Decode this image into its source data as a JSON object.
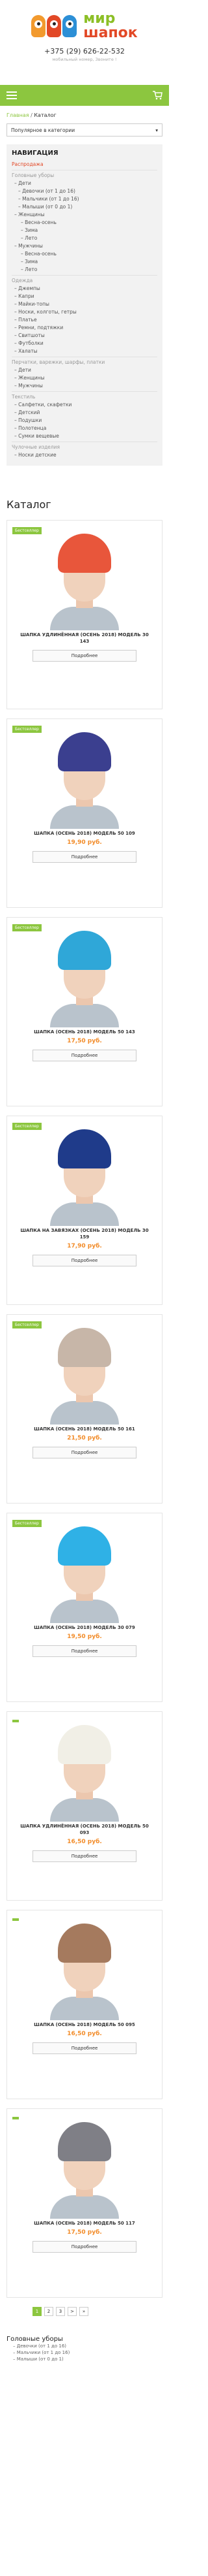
{
  "brand": {
    "line1": "мир",
    "line2": "шапок",
    "phone": "+375 (29) 626-22-532",
    "phone_sub": "мобильный номер, Звоните !"
  },
  "breadcrumb": {
    "home": "Главная",
    "current": "Каталог"
  },
  "sort": {
    "value": "Популярное в категории"
  },
  "nav": {
    "title": "НАВИГАЦИЯ",
    "items": [
      {
        "label": "Распродажа",
        "level": "l0",
        "style": "hl"
      },
      {
        "label": "Головные уборы",
        "level": "l0",
        "style": "cat"
      },
      {
        "label": "Дети",
        "level": "l1",
        "style": ""
      },
      {
        "label": "Девочки (от 1 до 16)",
        "level": "l2",
        "style": ""
      },
      {
        "label": "Мальчики (от 1 до 16)",
        "level": "l2",
        "style": ""
      },
      {
        "label": "Малыши (от 0 до 1)",
        "level": "l2",
        "style": ""
      },
      {
        "label": "Женщины",
        "level": "l1",
        "style": ""
      },
      {
        "label": "Весна-осень",
        "level": "l3",
        "style": ""
      },
      {
        "label": "Зима",
        "level": "l3",
        "style": ""
      },
      {
        "label": "Лето",
        "level": "l3",
        "style": ""
      },
      {
        "label": "Мужчины",
        "level": "l1",
        "style": ""
      },
      {
        "label": "Весна-осень",
        "level": "l3",
        "style": ""
      },
      {
        "label": "Зима",
        "level": "l3",
        "style": ""
      },
      {
        "label": "Лето",
        "level": "l3",
        "style": ""
      },
      {
        "label": "Одежда",
        "level": "l0",
        "style": "cat"
      },
      {
        "label": "Джемпы",
        "level": "l1",
        "style": ""
      },
      {
        "label": "Капри",
        "level": "l1",
        "style": ""
      },
      {
        "label": "Майки-топы",
        "level": "l1",
        "style": ""
      },
      {
        "label": "Носки, колготы, гетры",
        "level": "l1",
        "style": ""
      },
      {
        "label": "Платье",
        "level": "l1",
        "style": ""
      },
      {
        "label": "Ремни, подтяжки",
        "level": "l1",
        "style": ""
      },
      {
        "label": "Свитшоты",
        "level": "l1",
        "style": ""
      },
      {
        "label": "Футболки",
        "level": "l1",
        "style": ""
      },
      {
        "label": "Халаты",
        "level": "l1",
        "style": ""
      },
      {
        "label": "Перчатки, варежки, шарфы, платки",
        "level": "l0",
        "style": "cat"
      },
      {
        "label": "Дети",
        "level": "l1",
        "style": ""
      },
      {
        "label": "Женщины",
        "level": "l1",
        "style": ""
      },
      {
        "label": "Мужчины",
        "level": "l1",
        "style": ""
      },
      {
        "label": "Текстиль",
        "level": "l0",
        "style": "cat"
      },
      {
        "label": "Салфетки, скафетки",
        "level": "l1",
        "style": ""
      },
      {
        "label": "Детский",
        "level": "l1",
        "style": ""
      },
      {
        "label": "Подушки",
        "level": "l1",
        "style": ""
      },
      {
        "label": "Полотенца",
        "level": "l1",
        "style": ""
      },
      {
        "label": "Сумки вещевые",
        "level": "l1",
        "style": ""
      },
      {
        "label": "Чулочные изделия",
        "level": "l0",
        "style": "cat"
      },
      {
        "label": "Носки детские",
        "level": "l1",
        "style": ""
      }
    ]
  },
  "catalog_title": "Каталог",
  "products": [
    {
      "badge": "Бестселлер",
      "name": "ШАПКА УДЛИНЁННАЯ (ОСЕНЬ 2018) МОДЕЛЬ 30 143",
      "price": "",
      "hat": "#e8563b",
      "more": "Подробнее"
    },
    {
      "badge": "Бестселлер",
      "name": "ШАПКА (ОСЕНЬ 2018) МОДЕЛЬ 50 109",
      "price": "19,90 руб.",
      "hat": "#3b3f8f",
      "more": "Подробнее"
    },
    {
      "badge": "Бестселлер",
      "name": "ШАПКА (ОСЕНЬ 2018) МОДЕЛЬ 50 143",
      "price": "17,50 руб.",
      "hat": "#2fa7d8",
      "more": "Подробнее"
    },
    {
      "badge": "Бестселлер",
      "name": "ШАПКА НА ЗАВЯЗКАХ (ОСЕНЬ 2018) МОДЕЛЬ 30 159",
      "price": "17,90 руб.",
      "hat": "#1f3b8a",
      "more": "Подробнее"
    },
    {
      "badge": "Бестселлер",
      "name": "ШАПКА (ОСЕНЬ 2018) МОДЕЛЬ 50 161",
      "price": "21,50 руб.",
      "hat": "#c7b6a8",
      "more": "Подробнее"
    },
    {
      "badge": "Бестселлер",
      "name": "ШАПКА (ОСЕНЬ 2018) МОДЕЛЬ 30 079",
      "price": "19,50 руб.",
      "hat": "#2fb1e6",
      "more": "Подробнее"
    },
    {
      "badge": "",
      "name": "ШАПКА УДЛИНЁННАЯ (ОСЕНЬ 2018) МОДЕЛЬ 50 093",
      "price": "16,50 руб.",
      "hat": "#f1efe6",
      "more": "Подробнее"
    },
    {
      "badge": "",
      "name": "ШАПКА (ОСЕНЬ 2018) МОДЕЛЬ 50 095",
      "price": "16,50 руб.",
      "hat": "#a57a5e",
      "more": "Подробнее"
    },
    {
      "badge": "",
      "name": "ШАПКА (ОСЕНЬ 2018) МОДЕЛЬ 50 117",
      "price": "17,50 руб.",
      "hat": "#7f7f86",
      "more": "Подробнее"
    }
  ],
  "pager": [
    "1",
    "2",
    "3",
    ">",
    "»"
  ],
  "bottom": {
    "title": "Головные уборы",
    "items": [
      "Девочки (от 1 до 16)",
      "Мальчики (от 1 до 16)",
      "Малыши (от 0 до 1)"
    ]
  }
}
